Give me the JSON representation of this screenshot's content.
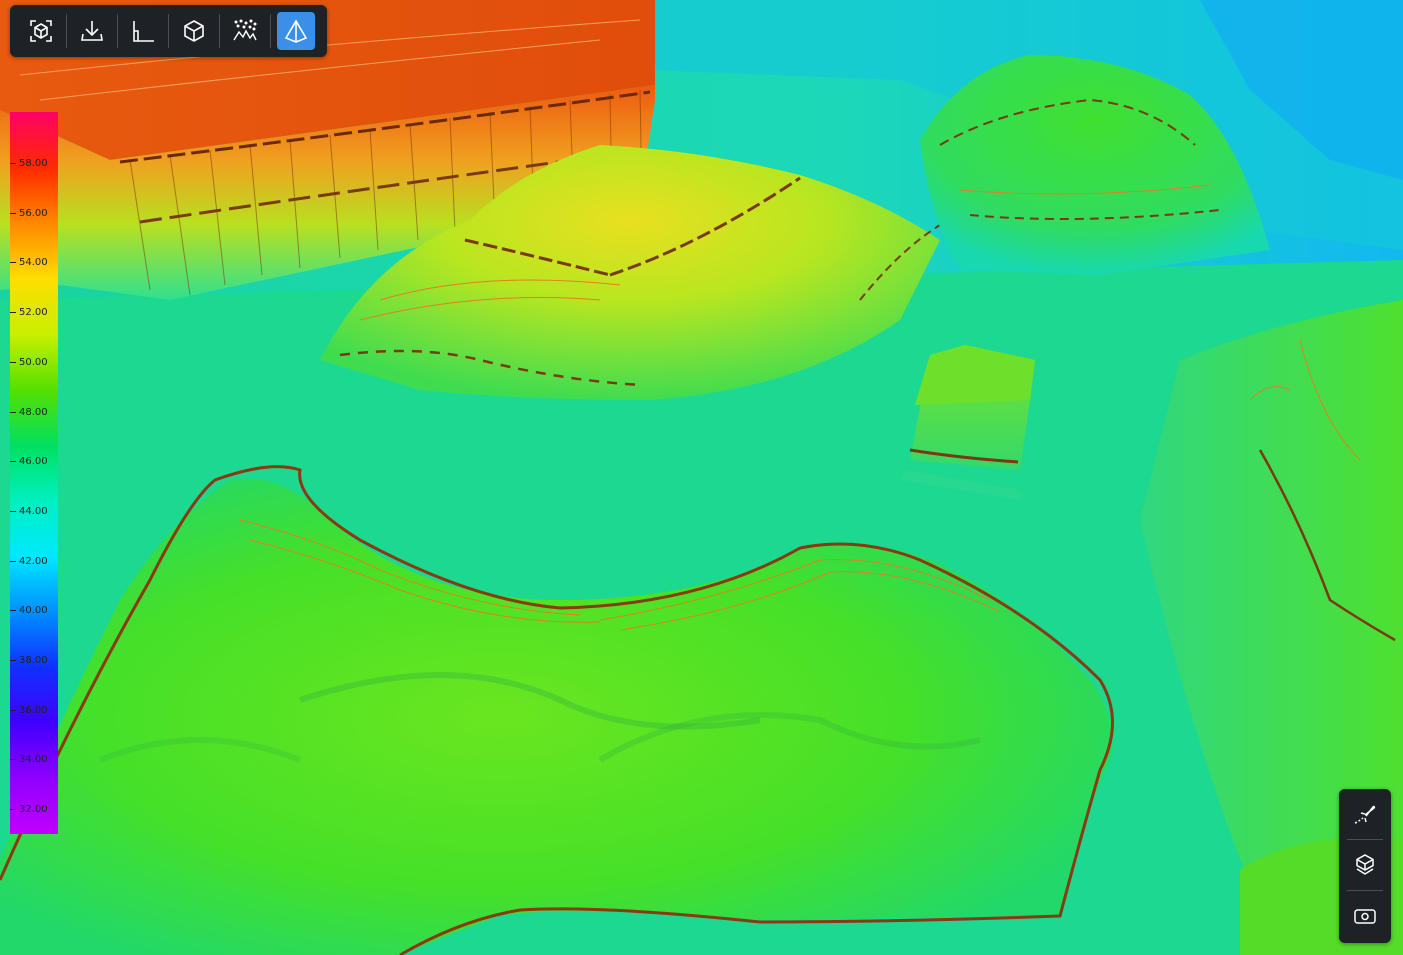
{
  "toolbar": {
    "tools": [
      {
        "icon": "scan-cube-icon",
        "active": false
      },
      {
        "icon": "download-icon",
        "active": false
      },
      {
        "icon": "axis-measure-icon",
        "active": false
      },
      {
        "icon": "cube-icon",
        "active": false
      },
      {
        "icon": "point-cloud-icon",
        "active": false
      },
      {
        "icon": "pyramid-icon",
        "active": true
      }
    ],
    "accent_color": "#3a8fe6"
  },
  "legend": {
    "labels": [
      "58.00",
      "56.00",
      "54.00",
      "52.00",
      "50.00",
      "48.00",
      "46.00",
      "44.00",
      "42.00",
      "40.00",
      "38.00",
      "36.00",
      "34.00",
      "32.00"
    ],
    "gradient_colors": [
      "#ff0066",
      "#ff2a00",
      "#ff8800",
      "#ffdd00",
      "#c8f000",
      "#55e000",
      "#00e060",
      "#00f0c0",
      "#00e8ff",
      "#0090ff",
      "#1030ff",
      "#4000ff",
      "#9000ff",
      "#c000ff"
    ]
  },
  "side_panel": {
    "tools": [
      {
        "icon": "flight-path-icon"
      },
      {
        "icon": "layers-icon"
      },
      {
        "icon": "camera-view-icon"
      }
    ]
  }
}
